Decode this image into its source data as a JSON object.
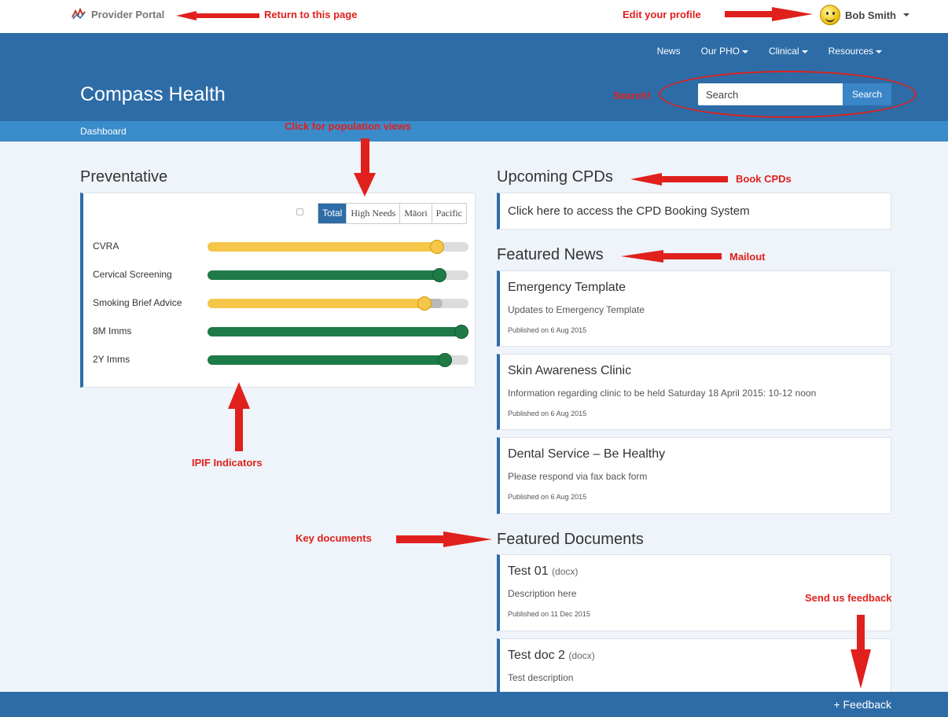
{
  "topbar": {
    "brand": "Provider Portal",
    "user": "Bob Smith"
  },
  "header": {
    "nav": [
      "News",
      "Our PHO",
      "Clinical",
      "Resources"
    ],
    "title": "Compass Health",
    "search_placeholder": "Search",
    "search_button": "Search"
  },
  "subbar": {
    "crumb": "Dashboard"
  },
  "preventative": {
    "title": "Preventative",
    "tabs": [
      "Total",
      "High Needs",
      "Māori",
      "Pacific"
    ],
    "active_tab": "Total",
    "indicators": [
      {
        "label": "CVRA",
        "value": 0.88,
        "color": "yellow"
      },
      {
        "label": "Cervical Screening",
        "value": 0.89,
        "color": "green"
      },
      {
        "label": "Smoking Brief Advice",
        "value": 0.83,
        "target": 0.9,
        "color": "yellow"
      },
      {
        "label": "8M Imms",
        "value": 1.0,
        "color": "green"
      },
      {
        "label": "2Y Imms",
        "value": 0.91,
        "color": "green"
      }
    ]
  },
  "cpd": {
    "title": "Upcoming CPDs",
    "link": "Click here to access the CPD Booking System"
  },
  "news": {
    "title": "Featured News",
    "items": [
      {
        "title": "Emergency Template",
        "desc": "Updates to Emergency Template",
        "published": "Published on 6 Aug 2015"
      },
      {
        "title": "Skin Awareness Clinic",
        "desc": "Information regarding clinic to be held Saturday 18 April 2015: 10-12 noon",
        "published": "Published on 6 Aug 2015"
      },
      {
        "title": "Dental Service – Be Healthy",
        "desc": "Please respond via fax back form",
        "published": "Published on 6 Aug 2015"
      }
    ]
  },
  "documents": {
    "title": "Featured Documents",
    "items": [
      {
        "title": "Test 01",
        "ext": "(docx)",
        "desc": "Description here",
        "published": "Published on 11 Dec 2015"
      },
      {
        "title": "Test doc 2",
        "ext": "(docx)",
        "desc": "Test description",
        "published": ""
      }
    ]
  },
  "footer": {
    "feedback": "+ Feedback"
  },
  "annotations": {
    "return": "Return to this page",
    "profile": "Edit your profile",
    "search": "Search!",
    "population": "Click for population views",
    "book_cpds": "Book CPDs",
    "mailout": "Mailout",
    "ipif": "IPIF Indicators",
    "key_docs": "Key documents",
    "feedback": "Send us feedback"
  },
  "colors": {
    "primary": "#2d6ca7",
    "accent": "#3a8bca",
    "annotation": "#e0201c",
    "indicator_yellow": "#f5c64a",
    "indicator_green": "#1e7a47"
  }
}
